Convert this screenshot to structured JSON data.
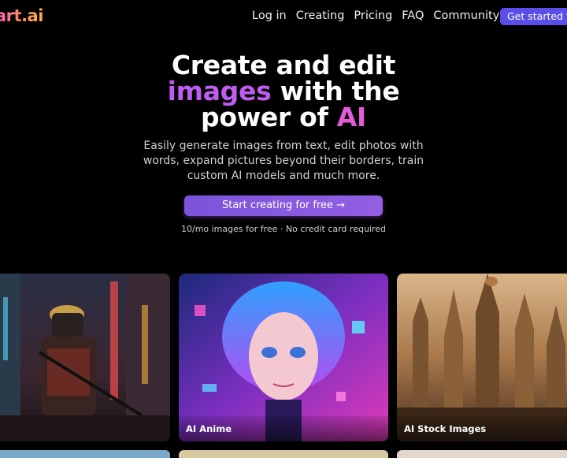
{
  "brand": {
    "logo_text": "art.ai"
  },
  "nav": {
    "links": [
      "Log in",
      "Creating",
      "Pricing",
      "FAQ"
    ],
    "community_label": "Community",
    "get_started_label": "Get started for free"
  },
  "hero": {
    "line1": "Create and edit",
    "line2_highlight": "images",
    "line2_rest": " with the",
    "line3_rest": "power of ",
    "line3_highlight": "AI",
    "subtitle": "Easily generate images from text, edit photos with words, expand pictures beyond their borders, train custom AI models and much more.",
    "cta_label": "Start creating for free →",
    "note": "10/mo images for free · No credit card required"
  },
  "gallery": {
    "cards": [
      {
        "label": ""
      },
      {
        "label": "AI Anime"
      },
      {
        "label": "AI Stock Images"
      }
    ]
  },
  "colors": {
    "accent_purple": "#c05cf0",
    "button_purple": "#7a54db",
    "nav_button": "#5b4ee8"
  }
}
